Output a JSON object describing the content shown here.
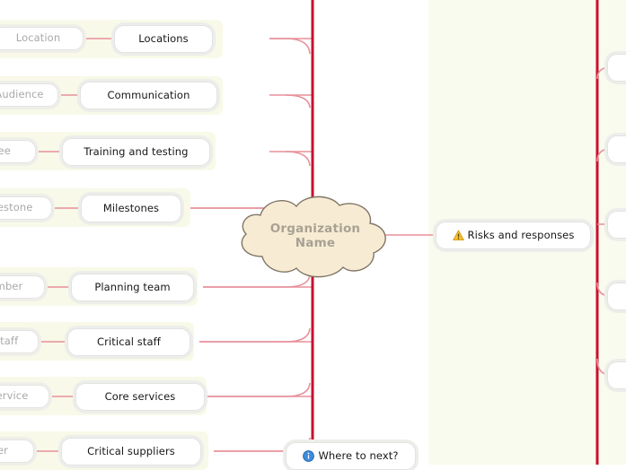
{
  "app": {
    "type": "mindmap",
    "center_node": {
      "line1": "Organization",
      "line2": "Name"
    },
    "colors": {
      "trunk": "#c8102e",
      "branch": "#e8909a",
      "band": "#f8f9e8",
      "panel": "#f9fbee",
      "cloud_fill": "#f7ecd3",
      "cloud_stroke": "#7f7566",
      "cloud_text": "#a9a193",
      "node_bg": "#ffffff",
      "node_border": "#e3e3e3",
      "node_shadow": "#eceeea",
      "ghost_text": "#a9a9a9",
      "warning": "#f5b800",
      "info": "#2a7fd4"
    }
  },
  "left_branches": [
    {
      "label": "Locations",
      "child": {
        "label": "Location",
        "truncated": false
      }
    },
    {
      "label": "Communication",
      "child": {
        "label": "Audience",
        "truncated": true
      }
    },
    {
      "label": "Training and testing",
      "child": {
        "label": "nee",
        "truncated": true
      }
    },
    {
      "label": "Milestones",
      "child": {
        "label": "lestone",
        "truncated": true
      }
    },
    {
      "label": "Planning team",
      "child": {
        "label": "mber",
        "truncated": true
      }
    },
    {
      "label": "Critical staff",
      "child": {
        "label": "Staff",
        "truncated": true
      }
    },
    {
      "label": "Core services",
      "child": {
        "label": "ervice",
        "truncated": true
      }
    },
    {
      "label": "Critical suppliers",
      "child": {
        "label": "er",
        "truncated": true
      }
    }
  ],
  "right_branches": [
    {
      "label": "Risks and responses",
      "icon": "warning-icon"
    }
  ],
  "bottom_branches": [
    {
      "label": "Where to next?",
      "icon": "info-icon"
    }
  ],
  "offscreen_right_nodes": [
    {
      "label": ""
    },
    {
      "label": ""
    },
    {
      "label": ""
    },
    {
      "label": ""
    },
    {
      "label": ""
    }
  ]
}
